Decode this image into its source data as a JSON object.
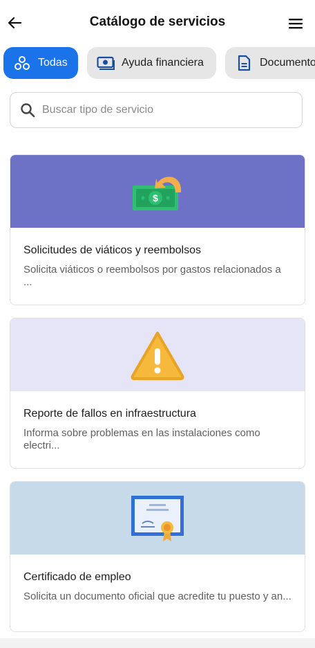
{
  "header": {
    "title": "Catálogo de servicios",
    "back_icon": "arrow-left-icon",
    "menu_icon": "hamburger-menu-icon"
  },
  "filters": [
    {
      "label": "Todas",
      "icon": "categories-icon",
      "active": true
    },
    {
      "label": "Ayuda financiera",
      "icon": "money-icon",
      "active": false
    },
    {
      "label": "Documentos",
      "icon": "document-icon",
      "active": false
    }
  ],
  "search": {
    "placeholder": "Buscar tipo de servicio",
    "value": "",
    "icon": "search-icon"
  },
  "services": [
    {
      "title": "Solicitudes de viáticos y reembolsos",
      "description": "Solicita viáticos o reembolsos por gastos relacionados a ...",
      "icon": "money-refund-icon",
      "banner_color": "#6e72c6"
    },
    {
      "title": "Reporte de fallos en infraestructura",
      "description": "Informa sobre problemas en las instalaciones como electri...",
      "icon": "warning-icon",
      "banner_color": "#e5e5f7"
    },
    {
      "title": "Certificado de empleo",
      "description": "Solicita un documento oficial que acredite tu puesto y an...",
      "icon": "certificate-icon",
      "banner_color": "#c7dae9"
    }
  ],
  "colors": {
    "accent": "#1a73e8",
    "chip_inactive": "#e6e6e6"
  }
}
